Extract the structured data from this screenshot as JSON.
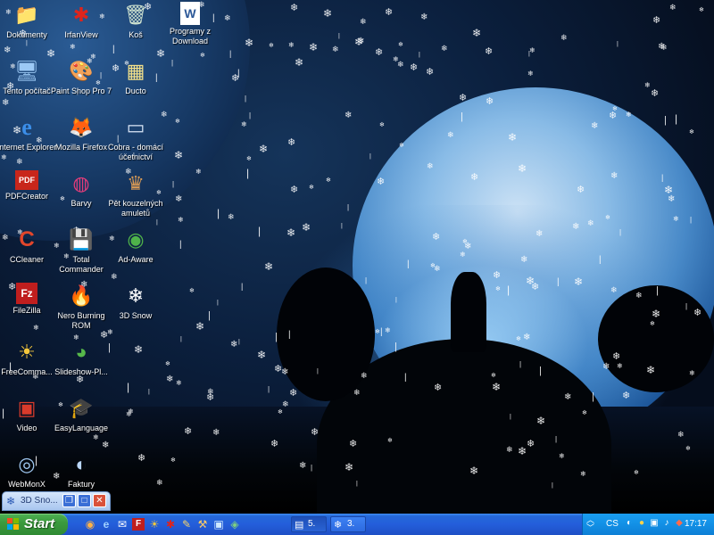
{
  "desktop": {
    "icons": [
      {
        "label": "Dokumenty",
        "icon": "my-documents-icon",
        "glyph": "📁"
      },
      {
        "label": "IrfanView",
        "icon": "irfanview-icon",
        "glyph": "✱"
      },
      {
        "label": "Koš",
        "icon": "recycle-bin-icon",
        "glyph": "🗑"
      },
      {
        "label": "Programy z Download",
        "icon": "word-document-icon",
        "glyph": "W"
      },
      {
        "label": "Tento počítač",
        "icon": "my-computer-icon",
        "glyph": "🖥"
      },
      {
        "label": "Paint Shop Pro 7",
        "icon": "paint-shop-pro-icon",
        "glyph": "🎨"
      },
      {
        "label": "Ducto",
        "icon": "ducto-icon",
        "glyph": "▦"
      },
      {
        "label": "Internet Explorer",
        "icon": "internet-explorer-icon",
        "glyph": "e"
      },
      {
        "label": "Mozilla Firefox",
        "icon": "firefox-icon",
        "glyph": "🦊"
      },
      {
        "label": "Cobra - domácí účetnictví",
        "icon": "cobra-icon",
        "glyph": "▭"
      },
      {
        "label": "PDFCreator",
        "icon": "pdfcreator-icon",
        "glyph": "PDF"
      },
      {
        "label": "Barvy",
        "icon": "barvy-icon",
        "glyph": "◍"
      },
      {
        "label": "Pět kouzelných amuletů",
        "icon": "game-icon",
        "glyph": "♛"
      },
      {
        "label": "CCleaner",
        "icon": "ccleaner-icon",
        "glyph": "C"
      },
      {
        "label": "Total Commander",
        "icon": "total-commander-icon",
        "glyph": "💾"
      },
      {
        "label": "Ad-Aware",
        "icon": "ad-aware-icon",
        "glyph": "◉"
      },
      {
        "label": "FileZilla",
        "icon": "filezilla-icon",
        "glyph": "Fz"
      },
      {
        "label": "Nero Burning ROM",
        "icon": "nero-icon",
        "glyph": "🔥"
      },
      {
        "label": "3D Snow",
        "icon": "snow-icon",
        "glyph": "❄"
      },
      {
        "label": "FreeComma...",
        "icon": "freecommander-icon",
        "glyph": "☀"
      },
      {
        "label": "Slideshow-Pl...",
        "icon": "slideshow-icon",
        "glyph": "◕"
      },
      {
        "label": "Video",
        "icon": "video-icon",
        "glyph": "▣"
      },
      {
        "label": "EasyLanguage",
        "icon": "easylanguage-icon",
        "glyph": "🎓"
      },
      {
        "label": "WebMonX",
        "icon": "webmonx-icon",
        "glyph": "◎"
      },
      {
        "label": "Faktury",
        "icon": "faktury-icon",
        "glyph": "◐"
      }
    ]
  },
  "window": {
    "title": "3D Sno...",
    "restore_glyph": "❐",
    "maximize_glyph": "□",
    "close_glyph": "✕"
  },
  "taskbar": {
    "start_label": "Start",
    "quick_launch": [
      {
        "icon": "firefox-icon",
        "glyph": "◉"
      },
      {
        "icon": "internet-explorer-icon",
        "glyph": "e"
      },
      {
        "icon": "mail-icon",
        "glyph": "✉"
      },
      {
        "icon": "filezilla-icon",
        "glyph": "F"
      },
      {
        "icon": "freecommander-icon",
        "glyph": "☀"
      },
      {
        "icon": "irfanview-icon",
        "glyph": "✱"
      },
      {
        "icon": "pencil-icon",
        "glyph": "✎"
      },
      {
        "icon": "tools-icon",
        "glyph": "⚒"
      },
      {
        "icon": "media-icon",
        "glyph": "▣"
      },
      {
        "icon": "ad-aware-icon",
        "glyph": "◈"
      }
    ],
    "tasks": [
      {
        "label": "5.",
        "icon": "folder-group-icon",
        "glyph": "▤",
        "active": true
      },
      {
        "label": "3.",
        "icon": "snow-icon",
        "glyph": "❄",
        "active": false
      }
    ],
    "tray": {
      "language": "CS",
      "icons": [
        {
          "icon": "network-icon",
          "glyph": "◐"
        },
        {
          "icon": "antivirus-icon",
          "glyph": "●"
        },
        {
          "icon": "monitor-icon",
          "glyph": "▣"
        },
        {
          "icon": "speaker-icon",
          "glyph": "♪"
        },
        {
          "icon": "shield-icon",
          "glyph": "◆"
        }
      ],
      "clock": "17:17"
    }
  },
  "colors": {
    "taskbar_blue": "#245edb",
    "start_green": "#3c9b3e",
    "tray_blue": "#1290e6"
  }
}
